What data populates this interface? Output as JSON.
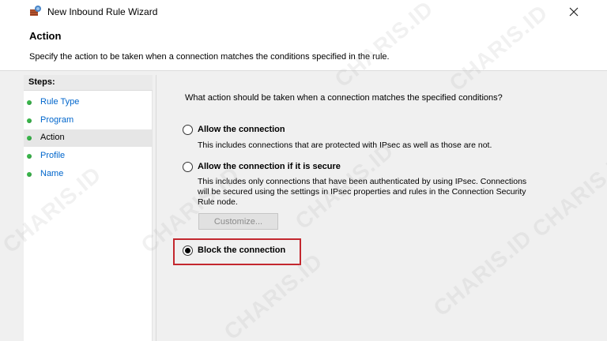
{
  "window": {
    "title": "New Inbound Rule Wizard",
    "close_symbol": "✕"
  },
  "header": {
    "title": "Action",
    "description": "Specify the action to be taken when a connection matches the conditions specified in the rule."
  },
  "steps": {
    "heading": "Steps:",
    "items": [
      {
        "label": "Rule Type",
        "active": false
      },
      {
        "label": "Program",
        "active": false
      },
      {
        "label": "Action",
        "active": true
      },
      {
        "label": "Profile",
        "active": false
      },
      {
        "label": "Name",
        "active": false
      }
    ]
  },
  "main": {
    "question": "What action should be taken when a connection matches the specified conditions?",
    "options": [
      {
        "label": "Allow the connection",
        "description": "This includes connections that are protected with IPsec as well as those are not.",
        "checked": false
      },
      {
        "label": "Allow the connection if it is secure",
        "description_lines": [
          "This includes only connections that have been authenticated by using IPsec.  Connections",
          "will be secured using the settings in IPsec properties and rules in the Connection Security",
          "Rule node."
        ],
        "checked": false
      },
      {
        "label": "Block the connection",
        "checked": true
      }
    ],
    "customize_label": "Customize..."
  },
  "watermark": {
    "text": "CHARIS.ID"
  },
  "colors": {
    "highlight": "#c3272e",
    "step_dot": "#39b54a",
    "link": "#0066cc"
  }
}
